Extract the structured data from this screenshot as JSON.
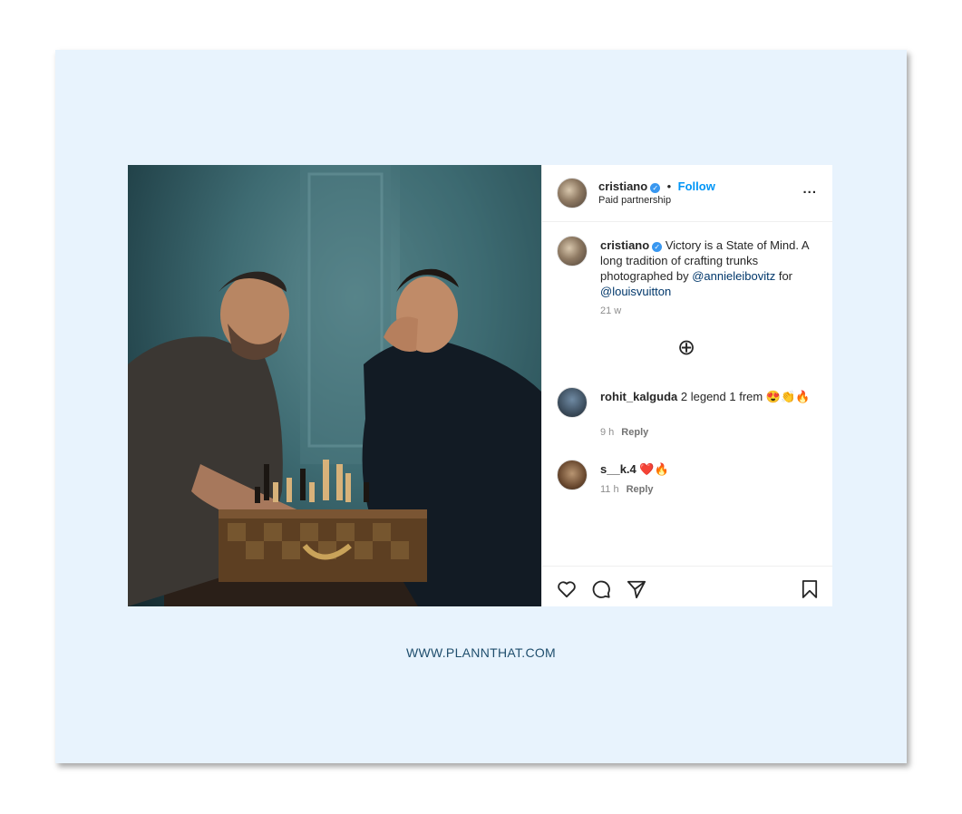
{
  "post": {
    "username": "cristiano",
    "follow_label": "Follow",
    "separator": "•",
    "subtitle": "Paid partnership",
    "more_label": "...",
    "caption": {
      "username": "cristiano",
      "text": "Victory is a State of Mind. A long tradition of crafting trunks photographed by",
      "mention1": "@annieleibovitz",
      "joiner": "for",
      "mention2": "@louisvuitton",
      "time": "21 w"
    },
    "load_more_label": "⊕",
    "comments": [
      {
        "username": "rohit_kalguda",
        "text": "2 legend 1 frem 😍👏🔥",
        "time": "9 h",
        "reply": "Reply"
      },
      {
        "username": "s__k.4",
        "text": "❤️🔥",
        "time": "11 h",
        "reply": "Reply"
      }
    ]
  },
  "footer": {
    "url": "WWW.PLANNTHAT.COM"
  },
  "colors": {
    "background": "#e8f3fd",
    "follow": "#0095f6",
    "link": "#00376b",
    "footer": "#1f4e6d"
  },
  "icons": [
    "like-icon",
    "comment-icon",
    "share-icon",
    "save-icon",
    "more-icon",
    "plus-circle-icon",
    "verified-icon"
  ]
}
